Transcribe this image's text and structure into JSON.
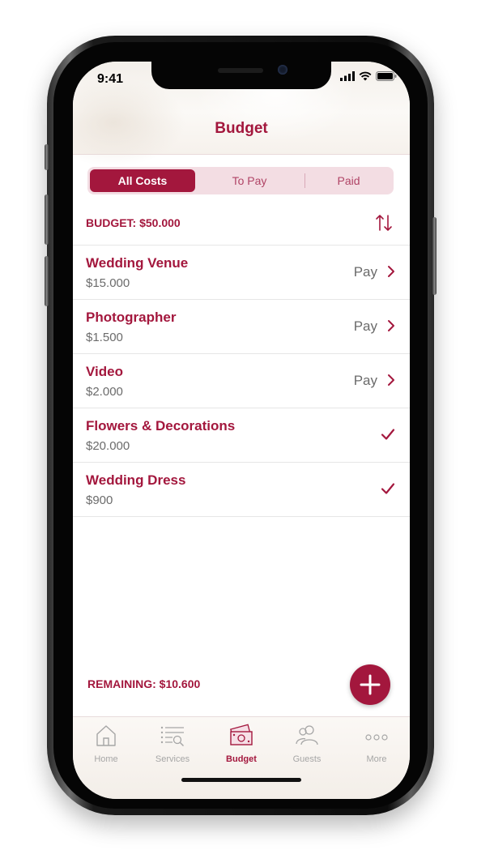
{
  "status_bar": {
    "time": "9:41"
  },
  "header": {
    "title": "Budget"
  },
  "segments": [
    {
      "label": "All Costs",
      "active": true
    },
    {
      "label": "To Pay",
      "active": false
    },
    {
      "label": "Paid",
      "active": false
    }
  ],
  "budget": {
    "label": "BUDGET: $50.000"
  },
  "items": [
    {
      "name": "Wedding Venue",
      "amount": "$15.000",
      "action": "Pay",
      "status": "to-pay"
    },
    {
      "name": "Photographer",
      "amount": "$1.500",
      "action": "Pay",
      "status": "to-pay"
    },
    {
      "name": "Video",
      "amount": "$2.000",
      "action": "Pay",
      "status": "to-pay"
    },
    {
      "name": "Flowers & Decorations",
      "amount": "$20.000",
      "action": "",
      "status": "paid"
    },
    {
      "name": "Wedding Dress",
      "amount": "$900",
      "action": "",
      "status": "paid"
    }
  ],
  "remaining": {
    "label": "REMAINING: $10.600"
  },
  "tabs": [
    {
      "label": "Home",
      "icon": "home-icon",
      "active": false
    },
    {
      "label": "Services",
      "icon": "services-icon",
      "active": false
    },
    {
      "label": "Budget",
      "icon": "budget-icon",
      "active": true
    },
    {
      "label": "Guests",
      "icon": "guests-icon",
      "active": false
    },
    {
      "label": "More",
      "icon": "more-icon",
      "active": false
    }
  ],
  "colors": {
    "accent": "#a3173d",
    "muted": "#6b6b6b",
    "segment_bg": "#f3dde3"
  }
}
